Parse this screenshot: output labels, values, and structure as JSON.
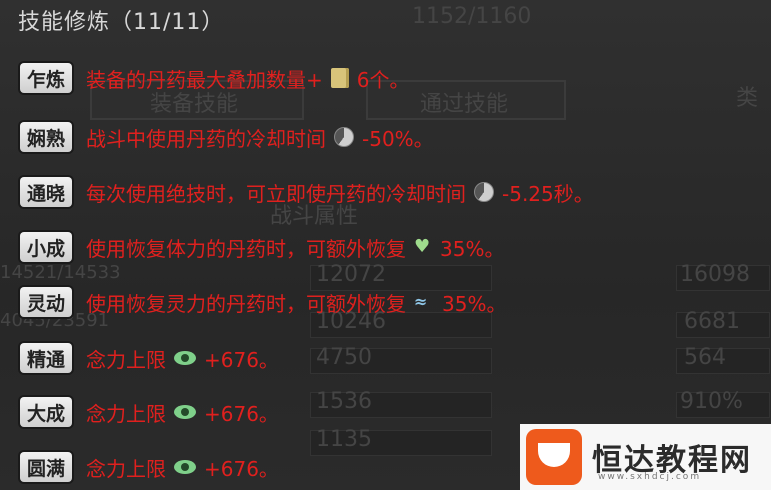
{
  "header": {
    "title": "技能修炼（11/11）",
    "bg_counter": "1152/1160"
  },
  "background": {
    "tab_left": "装备技能",
    "tab_mid": "通过技能",
    "tab_right": "类",
    "section": "战斗属性",
    "stats": [
      "12072",
      "10246",
      "4750",
      "1536",
      "1135"
    ],
    "stats_right": [
      "16098",
      "6681",
      "564",
      "910%"
    ],
    "left_vals": [
      "14521/14533",
      "4045/23591"
    ]
  },
  "skills": [
    {
      "tag": "乍炼",
      "text": "装备的丹药最大叠加数量+",
      "icon": "scroll-icon",
      "value": "6个。"
    },
    {
      "tag": "娴熟",
      "text": "战斗中使用丹药的冷却时间",
      "icon": "cooldown-icon",
      "value": "-50%。"
    },
    {
      "tag": "通晓",
      "text": "每次使用绝技时，可立即使丹药的冷却时间",
      "icon": "cooldown-icon",
      "value": "-5.25秒。"
    },
    {
      "tag": "小成",
      "text": "使用恢复体力的丹药时，可额外恢复",
      "icon": "heart-icon",
      "value": "35%。"
    },
    {
      "tag": "灵动",
      "text": "使用恢复灵力的丹药时，可额外恢复",
      "icon": "wave-icon",
      "value": "35%。"
    },
    {
      "tag": "精通",
      "text": "念力上限",
      "icon": "eye-icon",
      "value": "+676。"
    },
    {
      "tag": "大成",
      "text": "念力上限",
      "icon": "eye-icon",
      "value": "+676。"
    },
    {
      "tag": "圆满",
      "text": "念力上限",
      "icon": "eye-icon",
      "value": "+676。"
    }
  ],
  "watermark": {
    "name": "恒达教程网",
    "url": "www.sxhdcj.com"
  },
  "colors": {
    "accent": "#e0201e",
    "tag_bg": "#e6e6e6"
  }
}
